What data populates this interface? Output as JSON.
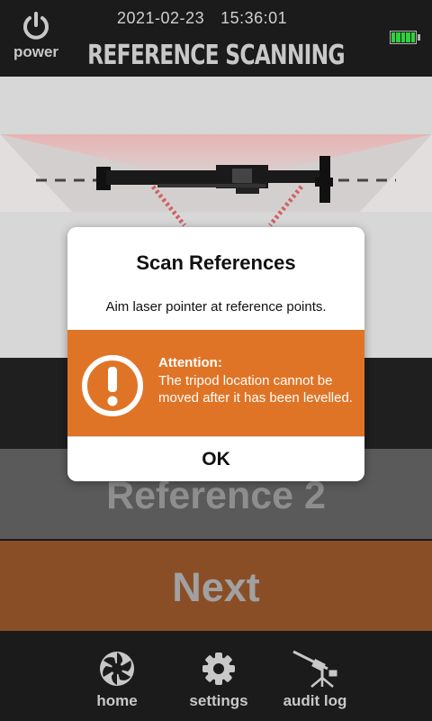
{
  "header": {
    "power_label": "power",
    "date": "2021-02-23",
    "time": "15:36:01",
    "title": "REFERENCE SCANNING",
    "battery_level": 1.0,
    "battery_color": "#2fd23a"
  },
  "buttons": {
    "reference2_label": "Reference 2",
    "next_label": "Next"
  },
  "nav": {
    "items": [
      {
        "label": "home",
        "icon": "aperture-icon"
      },
      {
        "label": "settings",
        "icon": "gear-icon"
      },
      {
        "label": "audit log",
        "icon": "laser-tripod-icon"
      }
    ]
  },
  "dialog": {
    "title": "Scan References",
    "message": "Aim laser pointer at reference points.",
    "attention_title": "Attention:",
    "attention_body": "The tripod location cannot be moved after it has been levelled.",
    "attention_icon": "exclamation-circle-icon",
    "ok_label": "OK"
  },
  "colors": {
    "header_bg": "#1b1b1b",
    "attention": "#e07426",
    "next_button": "#8a4e27",
    "reference_button": "#5a5a5a"
  }
}
